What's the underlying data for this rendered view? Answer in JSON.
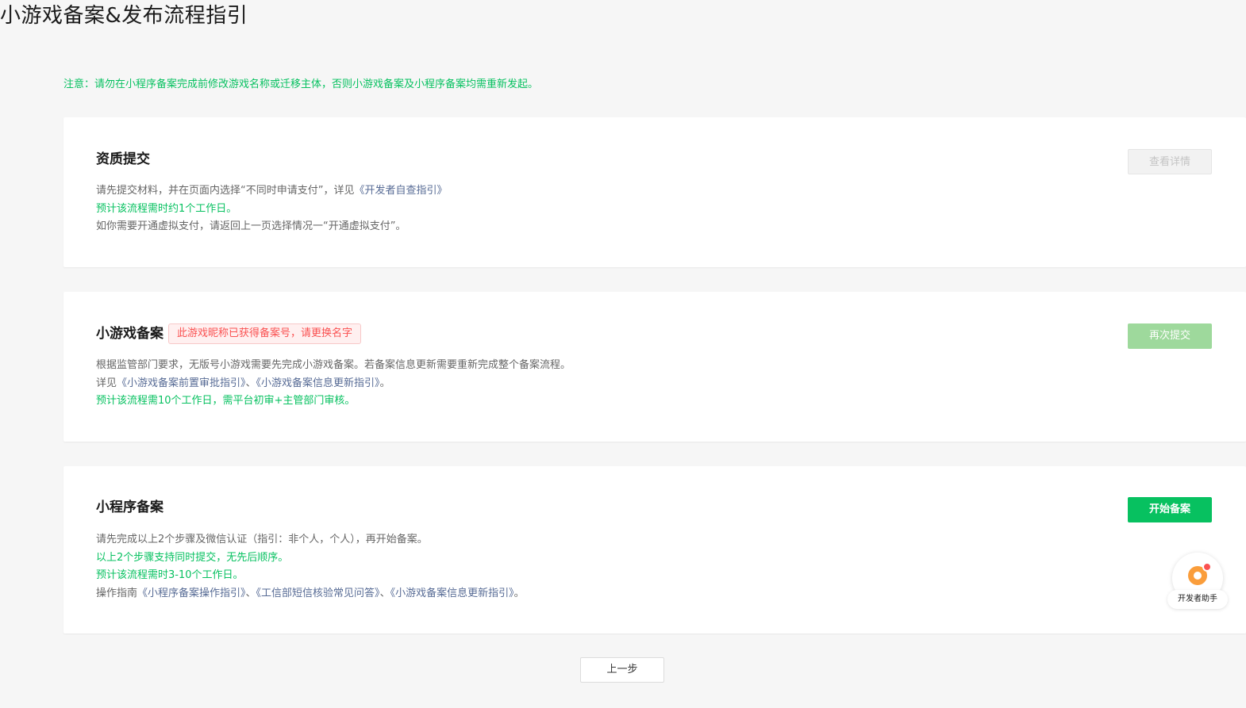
{
  "page_title": "小游戏备案&发布流程指引",
  "notice": "注意：请勿在小程序备案完成前修改游戏名称或迁移主体，否则小游戏备案及小程序备案均需重新发起。",
  "cards": [
    {
      "title": "资质提交",
      "button_label": "查看详情",
      "button_state": "disabled",
      "lines": [
        {
          "pre": "请先提交材料，并在页面内选择“不同时申请支付”，详见",
          "links": [
            "《开发者自查指引》"
          ],
          "post": "",
          "color": "gray"
        },
        {
          "pre": "预计该流程需时约1个工作日。",
          "links": [],
          "post": "",
          "color": "green"
        },
        {
          "pre": "如你需要开通虚拟支付，请返回上一页选择情况一“开通虚拟支付”。",
          "links": [],
          "post": "",
          "color": "gray"
        }
      ]
    },
    {
      "title": "小游戏备案",
      "tag": "此游戏昵称已获得备案号，请更换名字",
      "button_label": "再次提交",
      "button_state": "disabled",
      "lines": [
        {
          "pre": "根据监管部门要求，无版号小游戏需要先完成小游戏备案。若备案信息更新需要重新完成整个备案流程。",
          "links": [],
          "post": "",
          "color": "gray"
        },
        {
          "pre": "详见",
          "links": [
            "《小游戏备案前置审批指引》",
            "《小游戏备案信息更新指引》"
          ],
          "post": "。",
          "color": "gray"
        },
        {
          "pre": "预计该流程需10个工作日，需平台初审+主管部门审核。",
          "links": [],
          "post": "",
          "color": "green"
        }
      ]
    },
    {
      "title": "小程序备案",
      "button_label": "开始备案",
      "button_state": "enabled",
      "lines": [
        {
          "pre": "请先完成以上2个步骤及微信认证（指引：非个人，个人），再开始备案。",
          "links": [],
          "post": "",
          "color": "gray"
        },
        {
          "pre": "以上2个步骤支持同时提交，无先后顺序。",
          "links": [],
          "post": "",
          "color": "green"
        },
        {
          "pre": "预计该流程需时3-10个工作日。",
          "links": [],
          "post": "",
          "color": "green"
        },
        {
          "pre": "操作指南",
          "links": [
            "《小程序备案操作指引》",
            "《工信部短信核验常见问答》",
            "《小游戏备案信息更新指引》"
          ],
          "post": "。",
          "color": "gray"
        }
      ]
    }
  ],
  "link_separator": "、",
  "prev_button_label": "上一步",
  "assistant_label": "开发者助手",
  "colors": {
    "accent_green": "#07c160",
    "link_blue": "#576b95",
    "error_red": "#fa5151",
    "assistant_orange": "#fa9d3b"
  }
}
